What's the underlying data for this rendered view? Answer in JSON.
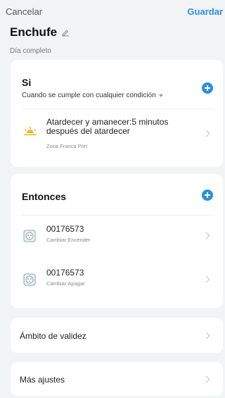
{
  "topbar": {
    "cancel": "Cancelar",
    "save": "Guardar"
  },
  "header": {
    "title": "Enchufe",
    "subtitle": "Día completo"
  },
  "if_section": {
    "title": "Si",
    "condition": "Cuando se cumple con cualquier condición",
    "trigger": {
      "title_line1": "Atardecer y amanecer:5 minutos",
      "title_line2": "después del atardecer",
      "location": "Zona Franca Port",
      "icon": "sunset-icon"
    }
  },
  "then_section": {
    "title": "Entonces",
    "actions": [
      {
        "device": "00176573",
        "action": "Cambiar:Encender",
        "icon": "smart-plug-icon"
      },
      {
        "device": "00176573",
        "action": "Cambiar:Apagar",
        "icon": "smart-plug-icon"
      }
    ]
  },
  "validity": {
    "label": "Ámbito de validez"
  },
  "more_settings": {
    "label": "Más ajustes"
  },
  "colors": {
    "accent": "#2a8fe0",
    "background": "#f2f3f5"
  }
}
